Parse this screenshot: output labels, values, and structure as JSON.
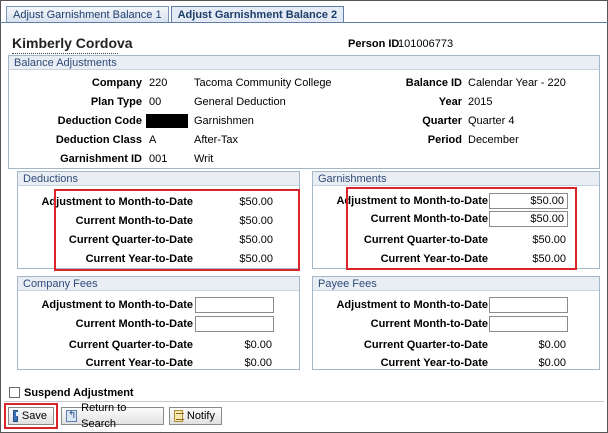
{
  "tabs": [
    {
      "label": "Adjust Garnishment Balance 1",
      "active": false
    },
    {
      "label": "Adjust Garnishment Balance 2",
      "active": true
    }
  ],
  "employee": {
    "name": "Kimberly Cordova",
    "person_id_label": "Person ID",
    "person_id": "101006773"
  },
  "balance_adjustments": {
    "title": "Balance Adjustments",
    "company_label": "Company",
    "company_code": "220",
    "company_name": "Tacoma Community College",
    "plan_type_label": "Plan Type",
    "plan_type_code": "00",
    "plan_type_name": "General Deduction",
    "deduction_code_label": "Deduction Code",
    "deduction_code_name": "Garnishmen",
    "deduction_class_label": "Deduction Class",
    "deduction_class_code": "A",
    "deduction_class_name": "After-Tax",
    "garnishment_id_label": "Garnishment ID",
    "garnishment_id": "001",
    "garnishment_type": "Writ",
    "balance_id_label": "Balance ID",
    "balance_id": "Calendar Year - 220",
    "year_label": "Year",
    "year": "2015",
    "quarter_label": "Quarter",
    "quarter": "Quarter 4",
    "period_label": "Period",
    "period": "December"
  },
  "deductions": {
    "title": "Deductions",
    "adj_mtd_label": "Adjustment to Month-to-Date",
    "adj_mtd": "$50.00",
    "mtd_label": "Current Month-to-Date",
    "mtd": "$50.00",
    "qtd_label": "Current Quarter-to-Date",
    "qtd": "$50.00",
    "ytd_label": "Current Year-to-Date",
    "ytd": "$50.00"
  },
  "garnishments": {
    "title": "Garnishments",
    "adj_mtd_label": "Adjustment to Month-to-Date",
    "adj_mtd": "$50.00",
    "mtd_label": "Current Month-to-Date",
    "mtd": "$50.00",
    "qtd_label": "Current Quarter-to-Date",
    "qtd": "$50.00",
    "ytd_label": "Current Year-to-Date",
    "ytd": "$50.00"
  },
  "company_fees": {
    "title": "Company Fees",
    "adj_mtd_label": "Adjustment to Month-to-Date",
    "adj_mtd": "",
    "mtd_label": "Current Month-to-Date",
    "mtd": "",
    "qtd_label": "Current Quarter-to-Date",
    "qtd": "$0.00",
    "ytd_label": "Current Year-to-Date",
    "ytd": "$0.00"
  },
  "payee_fees": {
    "title": "Payee Fees",
    "adj_mtd_label": "Adjustment to Month-to-Date",
    "adj_mtd": "",
    "mtd_label": "Current Month-to-Date",
    "mtd": "",
    "qtd_label": "Current Quarter-to-Date",
    "qtd": "$0.00",
    "ytd_label": "Current Year-to-Date",
    "ytd": "$0.00"
  },
  "suspend_label": "Suspend Adjustment",
  "buttons": {
    "save": "Save",
    "return": "Return to Search",
    "notify": "Notify"
  },
  "colors": {
    "highlight": "#d9242b",
    "group_header": "#2f4b78"
  }
}
